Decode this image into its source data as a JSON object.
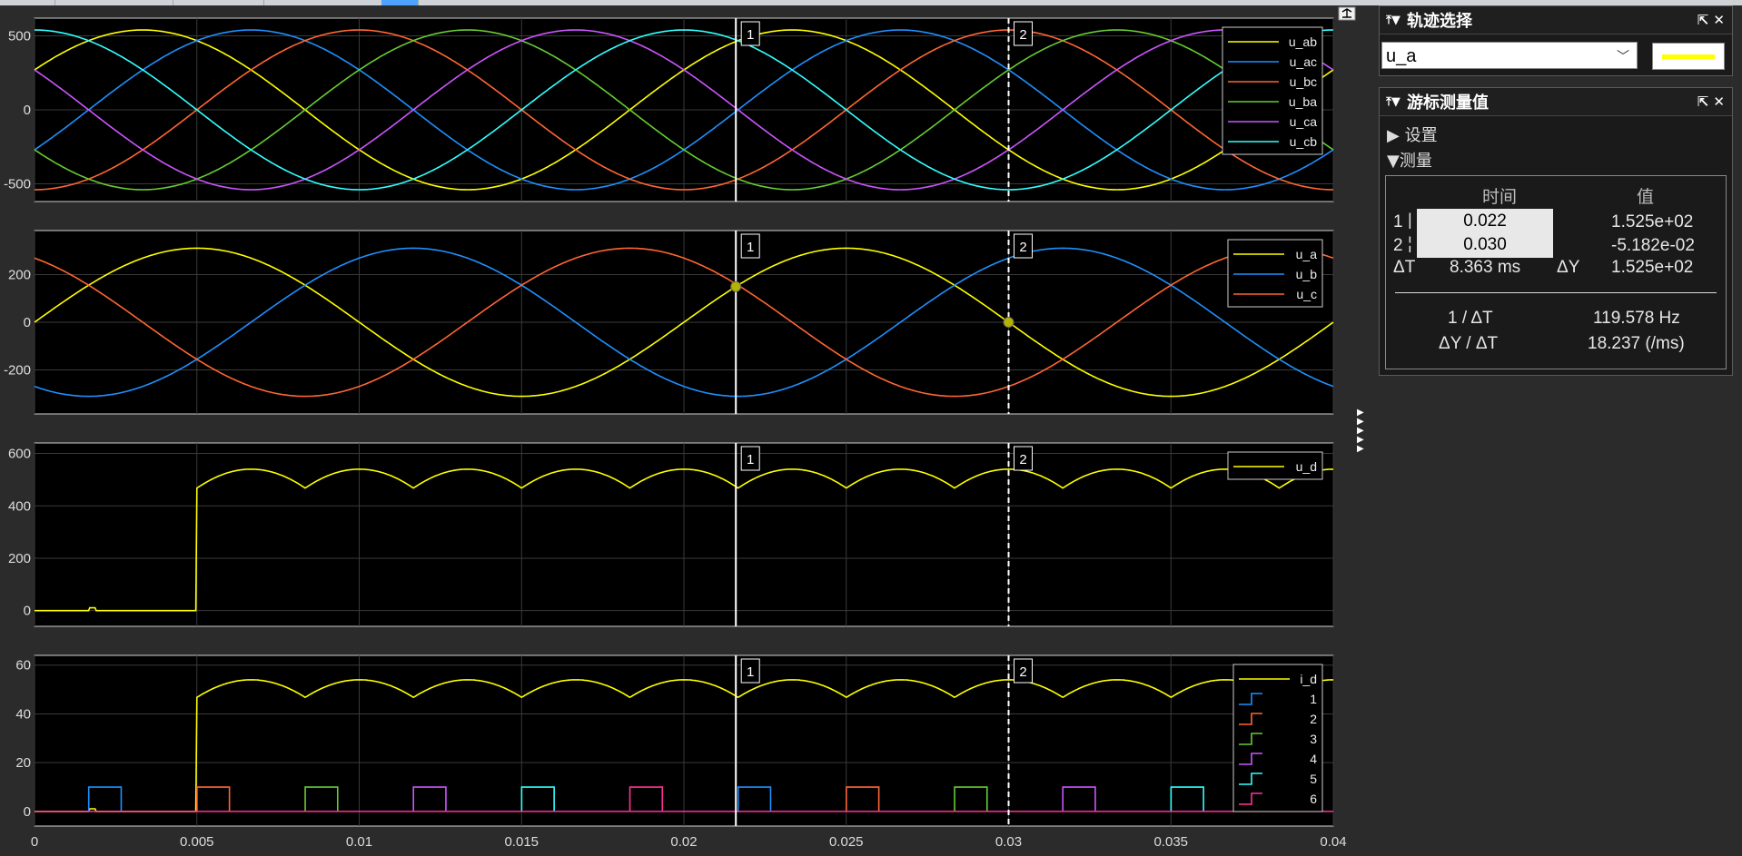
{
  "plots": [
    {
      "yticks": [
        500,
        0,
        -500
      ],
      "ylim": [
        -620,
        620
      ],
      "legend": [
        "u_ab",
        "u_ac",
        "u_bc",
        "u_ba",
        "u_ca",
        "u_cb"
      ],
      "colors": [
        "#ffff00",
        "#1e90ff",
        "#ff6633",
        "#66cc33",
        "#cc55ff",
        "#33ffff"
      ],
      "amplitude": 540,
      "phases_deg": [
        30,
        -30,
        -90,
        210,
        150,
        90
      ]
    },
    {
      "yticks": [
        200,
        0,
        -200
      ],
      "ylim": [
        -385,
        385
      ],
      "legend": [
        "u_a",
        "u_b",
        "u_c"
      ],
      "colors": [
        "#ffff00",
        "#1e90ff",
        "#ff6633"
      ],
      "amplitude": 311,
      "phases_deg": [
        0,
        -120,
        120
      ]
    },
    {
      "yticks": [
        600,
        400,
        200,
        0
      ],
      "ylim": [
        -60,
        640
      ],
      "legend": [
        "u_d"
      ],
      "colors": [
        "#ffff00"
      ]
    },
    {
      "yticks": [
        60,
        40,
        20,
        0
      ],
      "ylim": [
        -6,
        64
      ],
      "legend": [
        "i_d",
        "1",
        "2",
        "3",
        "4",
        "5",
        "6"
      ],
      "colors": [
        "#ffff00",
        "#1e90ff",
        "#ff6633",
        "#66cc33",
        "#cc55ff",
        "#33ffff",
        "#ff3399"
      ]
    }
  ],
  "xticks": [
    "0",
    "0.005",
    "0.01",
    "0.015",
    "0.02",
    "0.025",
    "0.03",
    "0.035",
    "0.04"
  ],
  "xlim": [
    0,
    0.04
  ],
  "frequency_hz": 50,
  "cursors": [
    {
      "label": "1",
      "t": 0.0216,
      "style": "solid"
    },
    {
      "label": "2",
      "t": 0.03,
      "style": "dashed"
    }
  ],
  "marker_color": "#b4b400",
  "trace_panel": {
    "title": "轨迹选择",
    "selected": "u_a",
    "swatch_color": "#ffff00"
  },
  "cursor_panel": {
    "title": "游标测量值",
    "settings_label": "设置",
    "measure_label": "测量",
    "col_time": "时间",
    "col_value": "值",
    "row1_label": "1",
    "row1_time": "0.022",
    "row1_value": "1.525e+02",
    "row2_label": "2",
    "row2_time": "0.030",
    "row2_value": "-5.182e-02",
    "dT_label": "ΔT",
    "dT_value": "8.363 ms",
    "dY_label": "ΔY",
    "dY_value": "1.525e+02",
    "inv_label": "1 / ΔT",
    "inv_value": "119.578 Hz",
    "slope_label": "ΔY / ΔT",
    "slope_value": "18.237 (/ms)"
  }
}
